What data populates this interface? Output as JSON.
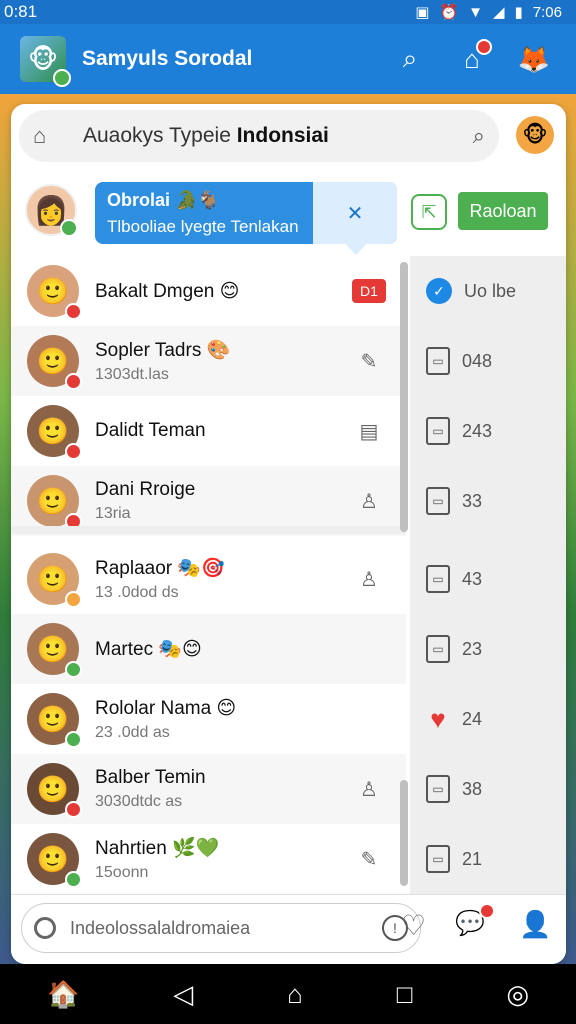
{
  "statusbar": {
    "time_left": "0:81",
    "time_right": "7:06"
  },
  "appbar": {
    "title": "Samyuls Sorodal"
  },
  "search": {
    "text_prefix": "Auaokys Typeie ",
    "text_bold": "Indonsiai"
  },
  "bubble": {
    "title": "Obrolai 🐊🐐",
    "subtitle": "Tlbooliae lyegte  Tenlakan",
    "close": "✕"
  },
  "action_button": {
    "label": "Raoloan"
  },
  "contacts": [
    {
      "name": "Bakalt Dmgen 😊",
      "sub": "",
      "status": "red",
      "icon": "D1",
      "avatar_bg": "#d9a27c"
    },
    {
      "name": "Sopler Tadrs 🎨",
      "sub": "1303dt.las",
      "status": "red",
      "icon": "✎",
      "avatar_bg": "#b37a57"
    },
    {
      "name": "Dalidt Teman",
      "sub": "",
      "status": "red",
      "icon": "▤",
      "avatar_bg": "#8b6448"
    },
    {
      "name": "Dani Rroige",
      "sub": "13ria",
      "status": "red",
      "icon": "♙",
      "avatar_bg": "#c9956e"
    },
    {
      "name": "Raplaaor 🎭🎯",
      "sub": "13 .0dod ds",
      "status": "orange",
      "icon": "♙",
      "avatar_bg": "#d7a072"
    },
    {
      "name": "Martec 🎭😊",
      "sub": "",
      "status": "green",
      "icon": "",
      "avatar_bg": "#a87756"
    },
    {
      "name": "Rololar Nama 😊",
      "sub": "23 .0dd as",
      "status": "green",
      "icon": "",
      "avatar_bg": "#8d6245"
    },
    {
      "name": "Balber Temin",
      "sub": "3030dtdc as",
      "status": "red",
      "icon": "♙",
      "avatar_bg": "#6b4a35"
    },
    {
      "name": "Nahrtien 🌿💚",
      "sub": "15oonn",
      "status": "green",
      "icon": "✎",
      "avatar_bg": "#7a5540"
    }
  ],
  "right_column": [
    {
      "type": "blue",
      "value": "Uo lbe"
    },
    {
      "type": "doc",
      "value": "048"
    },
    {
      "type": "doc",
      "value": "243"
    },
    {
      "type": "doc",
      "value": "33"
    },
    {
      "type": "doc",
      "value": "43"
    },
    {
      "type": "doc",
      "value": "23"
    },
    {
      "type": "heart",
      "value": "24"
    },
    {
      "type": "doc",
      "value": "38"
    },
    {
      "type": "doc",
      "value": "21"
    }
  ],
  "input": {
    "placeholder": "Indeolossalaldromaiea"
  },
  "colors": {
    "primary": "#1e7fd8",
    "green": "#4caf50",
    "red": "#e53935",
    "orange": "#f2a541"
  }
}
